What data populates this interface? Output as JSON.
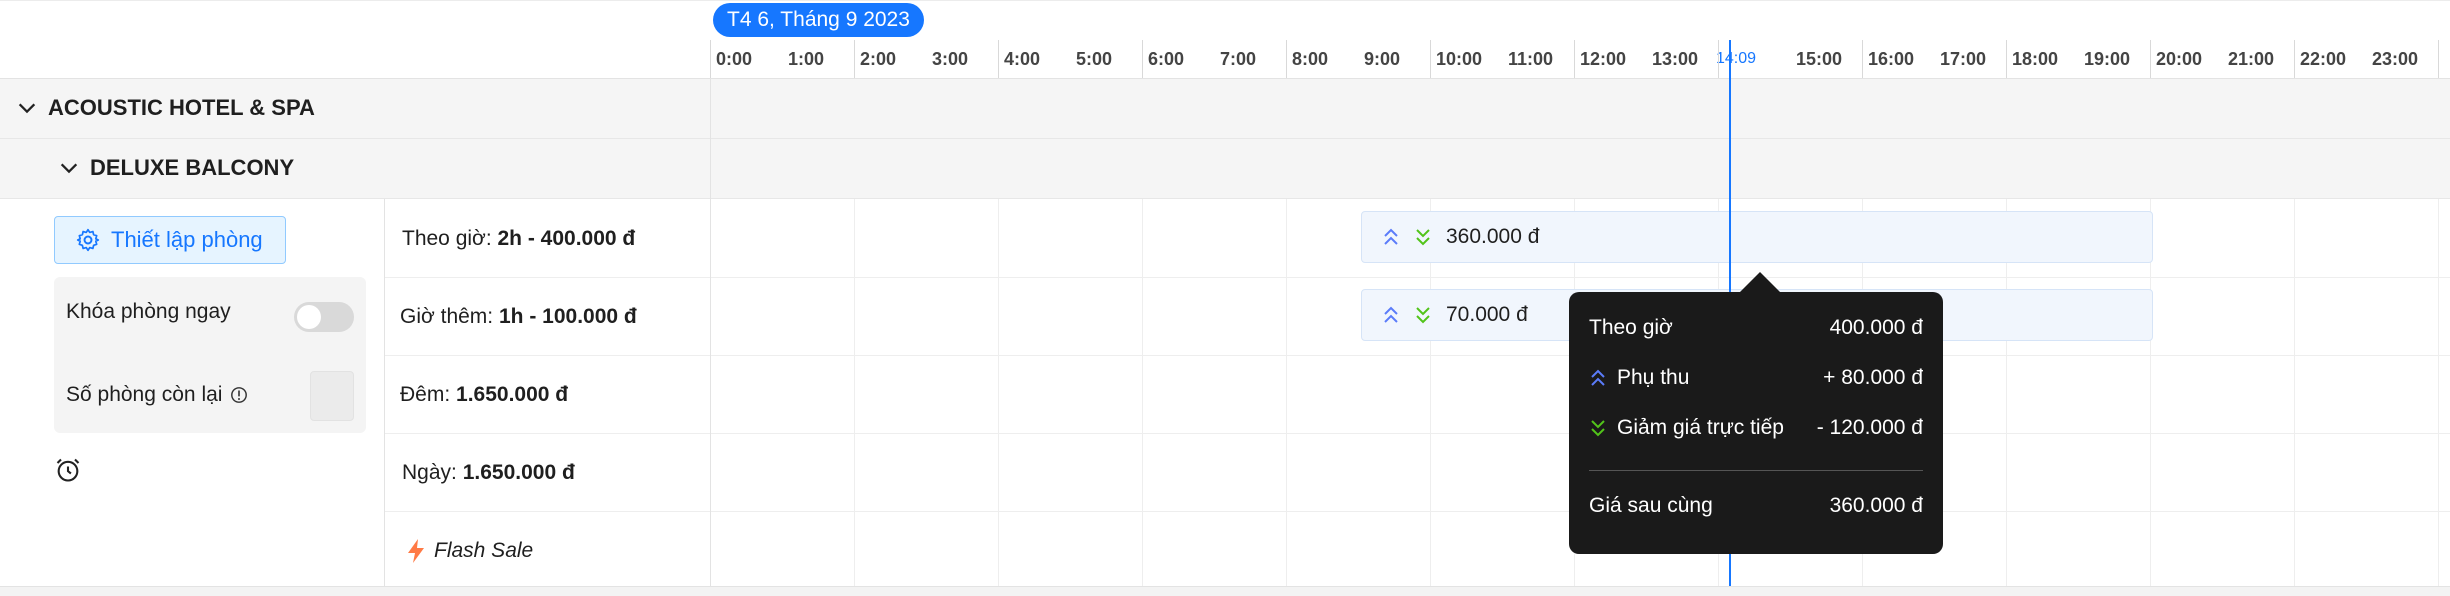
{
  "calendar": {
    "date_label": "T4 6, Tháng 9 2023",
    "hours": [
      "0:00",
      "1:00",
      "2:00",
      "3:00",
      "4:00",
      "5:00",
      "6:00",
      "7:00",
      "8:00",
      "9:00",
      "10:00",
      "11:00",
      "12:00",
      "13:00",
      "",
      "15:00",
      "16:00",
      "17:00",
      "18:00",
      "19:00",
      "20:00",
      "21:00",
      "22:00",
      "23:00"
    ],
    "now_label": "14:09"
  },
  "groups": {
    "hotel_name": "ACOUSTIC HOTEL & SPA",
    "room_type": "DELUXE BALCONY"
  },
  "settings": {
    "setup_label": "Thiết lập phòng",
    "lock_label": "Khóa phòng ngay",
    "lock_enabled": false,
    "rooms_left_label": "Số phòng còn lại",
    "rooms_left_value": ""
  },
  "prices": {
    "hourly_label": "Theo giờ:",
    "hourly_value": "2h - 400.000 đ",
    "extra_label": "Giờ thêm:",
    "extra_value": "1h - 100.000 đ",
    "night_label": "Đêm:",
    "night_value": "1.650.000 đ",
    "day_label": "Ngày:",
    "day_value": "1.650.000 đ",
    "flash_sale_label": "Flash Sale"
  },
  "bars": {
    "hourly_amount": "360.000 đ",
    "extra_amount": "70.000 đ"
  },
  "tooltip": {
    "base_label": "Theo giờ",
    "base_value": "400.000 đ",
    "surcharge_label": "Phụ thu",
    "surcharge_value": "+ 80.000 đ",
    "discount_label": "Giảm giá trực tiếp",
    "discount_value": "- 120.000 đ",
    "final_label": "Giá sau cùng",
    "final_value": "360.000 đ"
  },
  "colors": {
    "accent": "#1677ff",
    "up_arrow": "#5b7cfa",
    "down_arrow": "#52c41a",
    "flash": "#ff7a45"
  }
}
